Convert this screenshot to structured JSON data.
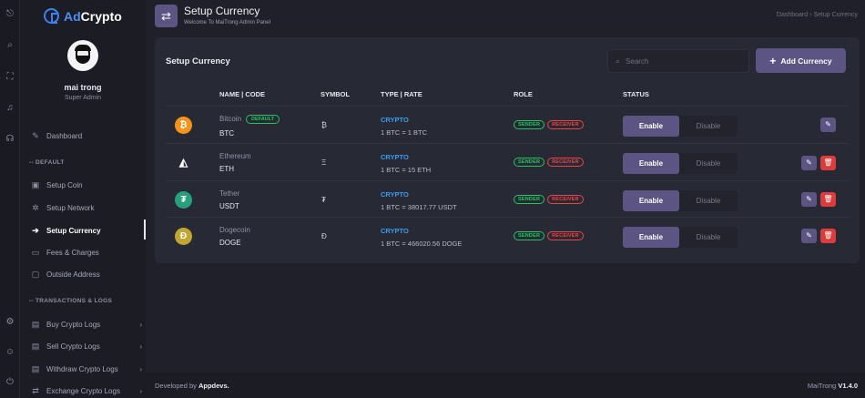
{
  "brand": {
    "prefix": "Ad",
    "suffix": "Crypto"
  },
  "user": {
    "name": "mai trong",
    "role": "Super Admin"
  },
  "header": {
    "title": "Setup Currency",
    "subtitle": "Welcome To MaiTrong Admin Panel",
    "breadcrumb": "Dashboard  ›  Setup Currency"
  },
  "nav": {
    "dashboard": "Dashboard",
    "section_default": "-- DEFAULT",
    "setup_coin": "Setup Coin",
    "setup_network": "Setup Network",
    "setup_currency": "Setup Currency",
    "fees": "Fees & Charges",
    "outside": "Outside Address",
    "section_tx": "-- TRANSACTIONS & LOGS",
    "buy_logs": "Buy Crypto Logs",
    "sell_logs": "Sell Crypto Logs",
    "withdraw_logs": "Withdraw Crypto Logs",
    "exchange_logs": "Exchange Crypto Logs"
  },
  "card": {
    "title": "Setup Currency",
    "search_placeholder": "Search",
    "add_label": "Add Currency",
    "columns": {
      "name": "NAME | CODE",
      "symbol": "SYMBOL",
      "type": "TYPE | RATE",
      "role": "ROLE",
      "status": "STATUS"
    }
  },
  "rows": [
    {
      "name": "Bitcoin",
      "code": "BTC",
      "default": "DEFAULT",
      "symbol": "₿",
      "type": "CRYPTO",
      "rate": "1 BTC = 1 BTC",
      "sender": "SENDER",
      "receiver": "RECEIVER",
      "enable": "Enable",
      "disable": "Disable"
    },
    {
      "name": "Ethereum",
      "code": "ETH",
      "symbol": "Ξ",
      "type": "CRYPTO",
      "rate": "1 BTC = 15 ETH",
      "sender": "SENDER",
      "receiver": "RECEIVER",
      "enable": "Enable",
      "disable": "Disable"
    },
    {
      "name": "Tether",
      "code": "USDT",
      "symbol": "₮",
      "type": "CRYPTO",
      "rate": "1 BTC = 38017.77 USDT",
      "sender": "SENDER",
      "receiver": "RECEIVER",
      "enable": "Enable",
      "disable": "Disable"
    },
    {
      "name": "Dogecoin",
      "code": "DOGE",
      "symbol": "Đ",
      "type": "CRYPTO",
      "rate": "1 BTC = 466020.56 DOGE",
      "sender": "SENDER",
      "receiver": "RECEIVER",
      "enable": "Enable",
      "disable": "Disable"
    }
  ],
  "footer": {
    "dev_prefix": "Developed by",
    "dev_name": "Appdevs.",
    "ver_prefix": "MaiTrong",
    "version": "V1.4.0"
  },
  "colors": {
    "accent": "#5c5583",
    "crypto": "#3b9cf0",
    "sender": "#22c55e",
    "receiver": "#ef4444"
  },
  "icons": {
    "rail": [
      "logout-icon",
      "search-icon",
      "fullscreen-icon",
      "bell-icon",
      "headset-icon",
      "settings-icon",
      "profile-icon",
      "power-icon"
    ]
  }
}
